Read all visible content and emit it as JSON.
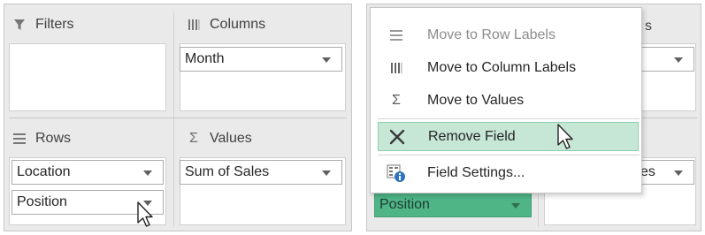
{
  "left_panel": {
    "filters": {
      "label": "Filters",
      "icon": "filter-icon"
    },
    "columns": {
      "label": "Columns",
      "icon": "columns-icon",
      "fields": [
        "Month"
      ]
    },
    "rows": {
      "label": "Rows",
      "icon": "rows-icon",
      "fields": [
        "Location",
        "Position"
      ]
    },
    "values": {
      "label": "Values",
      "icon": "sigma-icon",
      "symbol": "Σ",
      "fields": [
        "Sum of Sales"
      ]
    }
  },
  "right_panel": {
    "partial_columns_label": "s",
    "partial_values_field": "es",
    "dragged_field": "Position",
    "drag_color": "#4fb587",
    "menu": {
      "items": [
        {
          "label": "Move to Row Labels",
          "icon": "rows-icon",
          "state": "disabled"
        },
        {
          "label": "Move to Column Labels",
          "icon": "columns-icon",
          "state": "normal"
        },
        {
          "label": "Move to Values",
          "icon": "sigma-icon",
          "symbol": "Σ",
          "state": "normal"
        },
        {
          "label": "Remove Field",
          "icon": "remove-x-icon",
          "state": "highlighted"
        },
        {
          "label": "Field Settings...",
          "icon": "field-settings-info-icon",
          "state": "normal"
        }
      ],
      "highlight_color": "#c6e6d6"
    }
  }
}
